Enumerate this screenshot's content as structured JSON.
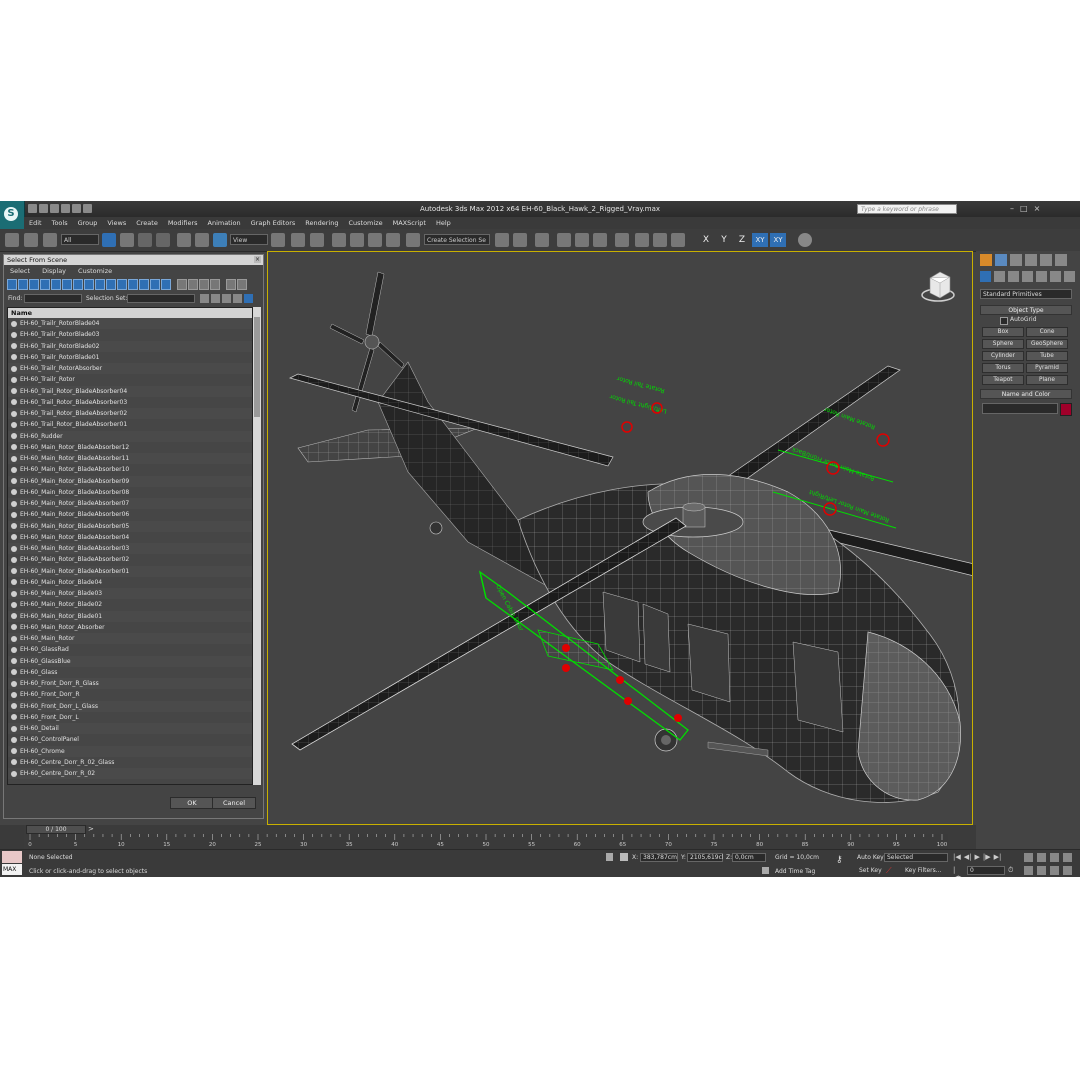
{
  "app": {
    "title": "Autodesk 3ds Max  2012 x64     EH-60_Black_Hawk_2_Rigged_Vray.max",
    "search_placeholder": "Type a keyword or phrase",
    "logo": "S"
  },
  "menu": [
    "Edit",
    "Tools",
    "Group",
    "Views",
    "Create",
    "Modifiers",
    "Animation",
    "Graph Editors",
    "Rendering",
    "Customize",
    "MAXScript",
    "Help"
  ],
  "toolbar": {
    "selection_filter": "All",
    "reference_coord": "View",
    "selection_set": "Create Selection Se",
    "axes": [
      "X",
      "Y",
      "Z",
      "XY",
      "XY"
    ]
  },
  "dialog": {
    "title": "Select From Scene",
    "menu": [
      "Select",
      "Display",
      "Customize"
    ],
    "find_label": "Find:",
    "selection_set_label": "Selection Set:",
    "column_header": "Name",
    "items": [
      "EH-60_Trailr_RotorBlade04",
      "EH-60_Trailr_RotorBlade03",
      "EH-60_Trailr_RotorBlade02",
      "EH-60_Trailr_RotorBlade01",
      "EH-60_Trailr_RotorAbsorber",
      "EH-60_Trailr_Rotor",
      "EH-60_Trail_Rotor_BladeAbsorber04",
      "EH-60_Trail_Rotor_BladeAbsorber03",
      "EH-60_Trail_Rotor_BladeAbsorber02",
      "EH-60_Trail_Rotor_BladeAbsorber01",
      "EH-60_Rudder",
      "EH-60_Main_Rotor_BladeAbsorber12",
      "EH-60_Main_Rotor_BladeAbsorber11",
      "EH-60_Main_Rotor_BladeAbsorber10",
      "EH-60_Main_Rotor_BladeAbsorber09",
      "EH-60_Main_Rotor_BladeAbsorber08",
      "EH-60_Main_Rotor_BladeAbsorber07",
      "EH-60_Main_Rotor_BladeAbsorber06",
      "EH-60_Main_Rotor_BladeAbsorber05",
      "EH-60_Main_Rotor_BladeAbsorber04",
      "EH-60_Main_Rotor_BladeAbsorber03",
      "EH-60_Main_Rotor_BladeAbsorber02",
      "EH-60_Main_Rotor_BladeAbsorber01",
      "EH-60_Main_Rotor_Blade04",
      "EH-60_Main_Rotor_Blade03",
      "EH-60_Main_Rotor_Blade02",
      "EH-60_Main_Rotor_Blade01",
      "EH-60_Main_Rotor_Absorber",
      "EH-60_Main_Rotor",
      "EH-60_GlassRad",
      "EH-60_GlassBlue",
      "EH-60_Glass",
      "EH-60_Front_Dorr_R_Glass",
      "EH-60_Front_Dorr_R",
      "EH-60_Front_Dorr_L_Glass",
      "EH-60_Front_Dorr_L",
      "EH-60_Detail",
      "EH-60_ControlPanel",
      "EH-60_Chrome",
      "EH-60_Centre_Dorr_R_02_Glass",
      "EH-60_Centre_Dorr_R_02"
    ],
    "ok_label": "OK",
    "cancel_label": "Cancel"
  },
  "command_panel": {
    "dropdown": "Standard Primitives",
    "object_type_header": "Object Type",
    "autogrid_label": "AutoGrid",
    "object_buttons": [
      "Box",
      "Cone",
      "Sphere",
      "GeoSphere",
      "Cylinder",
      "Tube",
      "Torus",
      "Pyramid",
      "Teapot",
      "Plane"
    ],
    "name_color_header": "Name and Color",
    "object_color": "#a0002a"
  },
  "viewport": {
    "annotations": [
      "Rotate Tail Rotor",
      "Left/Right Tail Rotor",
      "Rotate Main Rotor",
      "Rotate Main Rotor Front/Back",
      "Rotate Main Rotor Left/Right",
      "Open Cabin Door"
    ],
    "gizmo_color": "#00dd00",
    "handle_color": "#e00000"
  },
  "timeline": {
    "frame_counter": "0 / 100",
    "ticks": [
      "0",
      "5",
      "10",
      "15",
      "20",
      "25",
      "30",
      "35",
      "40",
      "45",
      "50",
      "55",
      "60",
      "65",
      "70",
      "75",
      "80",
      "85",
      "90",
      "95",
      "100"
    ]
  },
  "status": {
    "maxscript_label": "MAX",
    "selection": "None Selected",
    "prompt": "Click or click-and-drag to select objects",
    "x_label": "X:",
    "x_value": "383,787cm",
    "y_label": "Y:",
    "y_value": "2105,619cl",
    "z_label": "Z:",
    "z_value": "0,0cm",
    "grid": "Grid = 10,0cm",
    "add_time_tag": "Add Time Tag",
    "auto_key": "Auto Key",
    "set_key": "Set Key",
    "key_mode": "Selected",
    "key_filters": "Key Filters...",
    "current_frame": "0"
  }
}
